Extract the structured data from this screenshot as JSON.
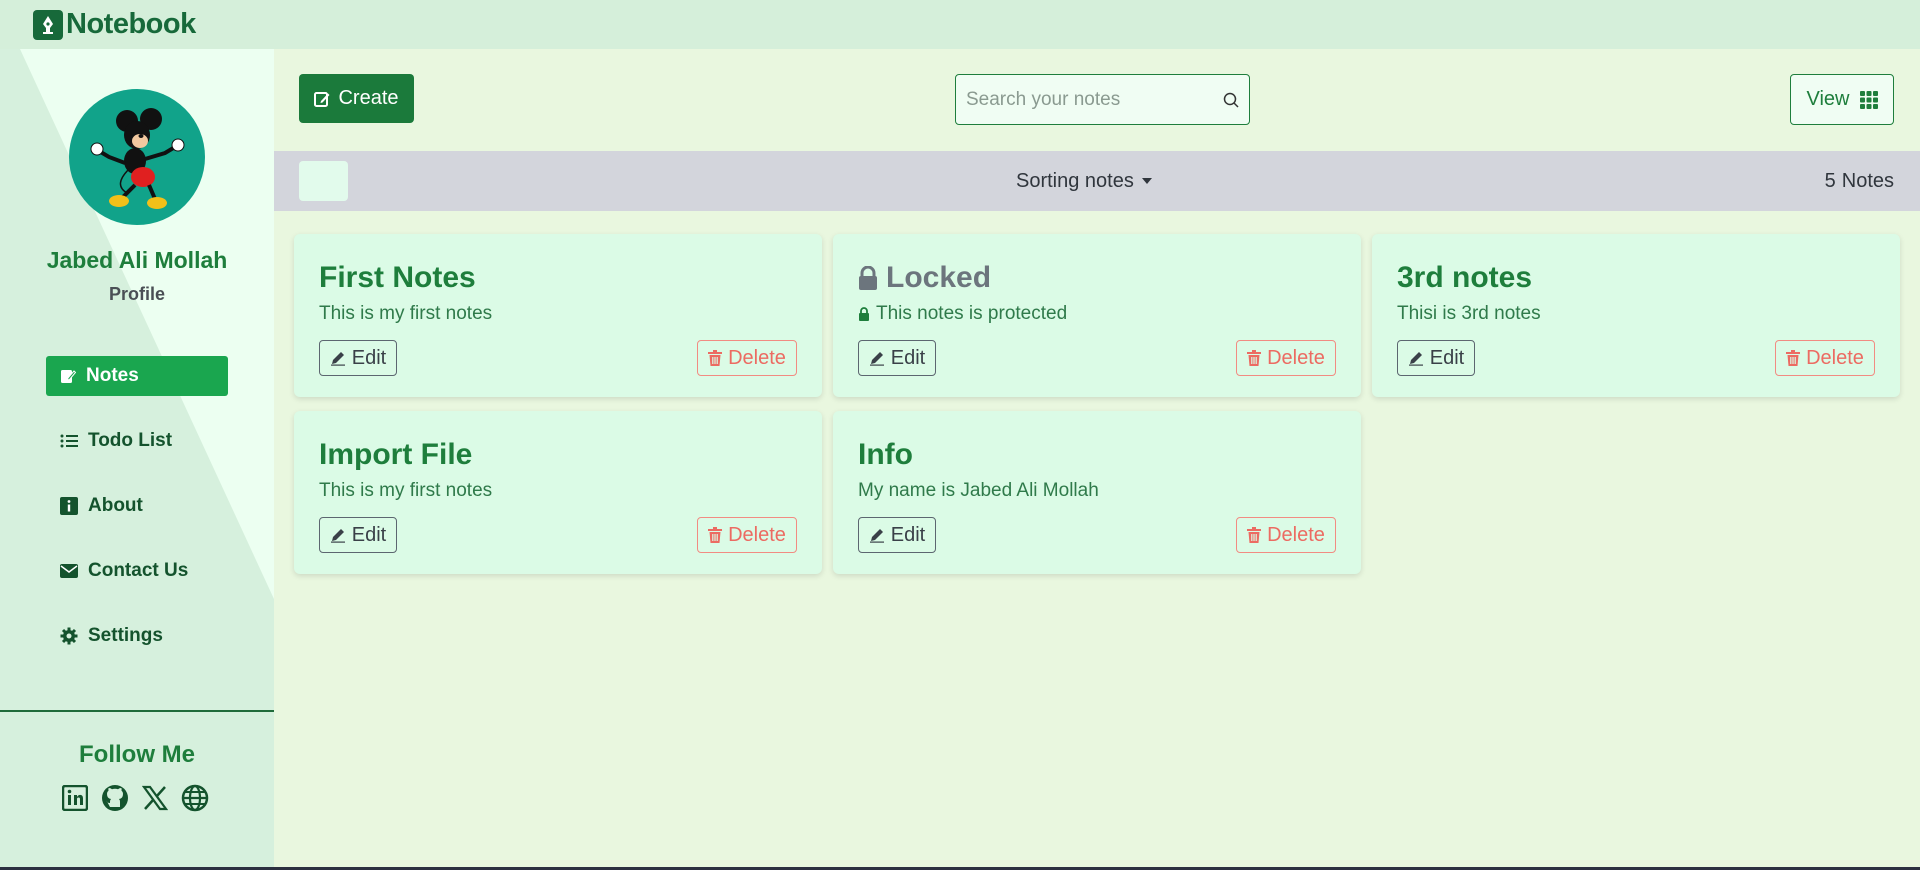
{
  "app": {
    "title": "Notebook"
  },
  "profile": {
    "name": "Jabed Ali Mollah",
    "subtitle": "Profile"
  },
  "nav": [
    {
      "label": "Notes",
      "icon": "note-edit-icon",
      "active": true
    },
    {
      "label": "Todo List",
      "icon": "list-icon",
      "active": false
    },
    {
      "label": "About",
      "icon": "info-icon",
      "active": false
    },
    {
      "label": "Contact Us",
      "icon": "envelope-icon",
      "active": false
    },
    {
      "label": "Settings",
      "icon": "gear-icon",
      "active": false
    }
  ],
  "follow": {
    "title": "Follow Me",
    "icons": [
      "linkedin-icon",
      "github-icon",
      "x-icon",
      "globe-icon"
    ]
  },
  "toolbar": {
    "create_label": "Create",
    "search_placeholder": "Search your notes",
    "view_label": "View"
  },
  "sort": {
    "label": "Sorting notes",
    "count": "5",
    "count_label": "Notes"
  },
  "notes": [
    {
      "title": "First Notes",
      "text": "This is my first notes",
      "locked": false,
      "edit_label": "Edit",
      "delete_label": "Delete"
    },
    {
      "title": "Locked",
      "text": "This notes is protected",
      "locked": true,
      "edit_label": "Edit",
      "delete_label": "Delete"
    },
    {
      "title": "3rd notes",
      "text": "Thisi is 3rd notes",
      "locked": false,
      "edit_label": "Edit",
      "delete_label": "Delete"
    },
    {
      "title": "Import File",
      "text": "This is my first notes",
      "locked": false,
      "edit_label": "Edit",
      "delete_label": "Delete"
    },
    {
      "title": "Info",
      "text": "My name is Jabed Ali Mollah",
      "locked": false,
      "edit_label": "Edit",
      "delete_label": "Delete"
    }
  ],
  "colors": {
    "primary": "#1b7a3b",
    "active_nav": "#1aa64f",
    "card_bg": "#dbfbe6",
    "page_bg": "#e9f7df",
    "danger": "#ec6b62",
    "sort_bar": "#d3d5dc"
  }
}
